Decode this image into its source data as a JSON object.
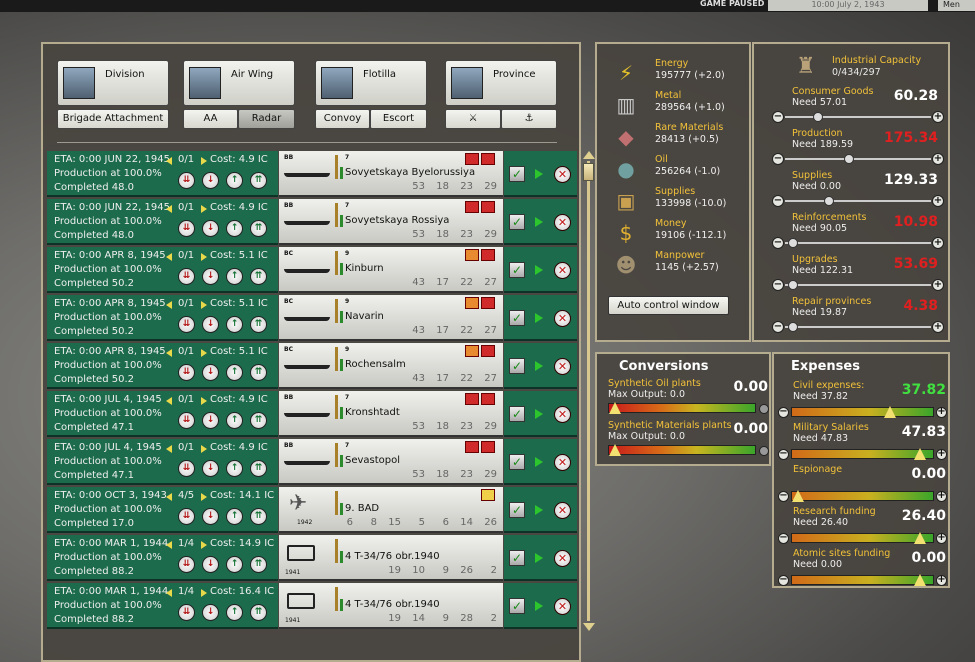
{
  "topbar": {
    "status": "GAME PAUSED",
    "date": "10:00 July 2, 1943",
    "menu": "Men"
  },
  "unit_buttons": [
    {
      "label": "Division"
    },
    {
      "label": "Air Wing"
    },
    {
      "label": "Flotilla"
    },
    {
      "label": "Province"
    }
  ],
  "sub_buttons": {
    "brigade": "Brigade Attachment",
    "aa": "AA",
    "radar": "Radar",
    "convoy": "Convoy",
    "escort": "Escort",
    "province_a": "⚔",
    "province_b": "⚓"
  },
  "queue": [
    {
      "eta": "ETA: 0:00 JUN 22, 1945",
      "qty": "0/1",
      "cost": "Cost: 4.9 IC",
      "prod": "Production at 100.0%",
      "done": "Completed 48.0",
      "cls": "BB",
      "num": "7",
      "name": "Sovyetskaya Byelorussiya",
      "stats": [
        "53",
        "18",
        "23",
        "29"
      ],
      "badges": [
        "red",
        "red"
      ],
      "kind": "ship"
    },
    {
      "eta": "ETA: 0:00 JUN 22, 1945",
      "qty": "0/1",
      "cost": "Cost: 4.9 IC",
      "prod": "Production at 100.0%",
      "done": "Completed 48.0",
      "cls": "BB",
      "num": "7",
      "name": "Sovyetskaya Rossiya",
      "stats": [
        "53",
        "18",
        "23",
        "29"
      ],
      "badges": [
        "red",
        "red"
      ],
      "kind": "ship"
    },
    {
      "eta": "ETA: 0:00 APR 8, 1945",
      "qty": "0/1",
      "cost": "Cost: 5.1 IC",
      "prod": "Production at 100.0%",
      "done": "Completed 50.2",
      "cls": "BC",
      "num": "9",
      "name": "Kinburn",
      "stats": [
        "43",
        "17",
        "22",
        "27"
      ],
      "badges": [
        "o",
        "red"
      ],
      "kind": "ship"
    },
    {
      "eta": "ETA: 0:00 APR 8, 1945",
      "qty": "0/1",
      "cost": "Cost: 5.1 IC",
      "prod": "Production at 100.0%",
      "done": "Completed 50.2",
      "cls": "BC",
      "num": "9",
      "name": "Navarin",
      "stats": [
        "43",
        "17",
        "22",
        "27"
      ],
      "badges": [
        "o",
        "red"
      ],
      "kind": "ship"
    },
    {
      "eta": "ETA: 0:00 APR 8, 1945",
      "qty": "0/1",
      "cost": "Cost: 5.1 IC",
      "prod": "Production at 100.0%",
      "done": "Completed 50.2",
      "cls": "BC",
      "num": "9",
      "name": "Rochensalm",
      "stats": [
        "43",
        "17",
        "22",
        "27"
      ],
      "badges": [
        "o",
        "red"
      ],
      "kind": "ship"
    },
    {
      "eta": "ETA: 0:00 JUL 4, 1945",
      "qty": "0/1",
      "cost": "Cost: 4.9 IC",
      "prod": "Production at 100.0%",
      "done": "Completed 47.1",
      "cls": "BB",
      "num": "7",
      "name": "Kronshtadt",
      "stats": [
        "53",
        "18",
        "23",
        "29"
      ],
      "badges": [
        "red",
        "red"
      ],
      "kind": "ship"
    },
    {
      "eta": "ETA: 0:00 JUL 4, 1945",
      "qty": "0/1",
      "cost": "Cost: 4.9 IC",
      "prod": "Production at 100.0%",
      "done": "Completed 47.1",
      "cls": "BB",
      "num": "7",
      "name": "Sevastopol",
      "stats": [
        "53",
        "18",
        "23",
        "29"
      ],
      "badges": [
        "red",
        "red"
      ],
      "kind": "ship"
    },
    {
      "eta": "ETA: 0:00 OCT 3, 1943",
      "qty": "4/5",
      "cost": "Cost: 14.1 IC",
      "prod": "Production at 100.0%",
      "done": "Completed 17.0",
      "cls": "",
      "num": "",
      "year": "1942",
      "name": "9. BAD",
      "stats": [
        "6",
        "8",
        "15",
        "5",
        "6",
        "14",
        "26"
      ],
      "badges": [
        "y"
      ],
      "kind": "air"
    },
    {
      "eta": "ETA: 0:00 MAR 1, 1944",
      "qty": "1/4",
      "cost": "Cost: 14.9 IC",
      "prod": "Production at 100.0%",
      "done": "Completed 88.2",
      "cls": "",
      "num": "",
      "year": "1941",
      "name": "4 T-34/76 obr.1940",
      "stats": [
        "19",
        "10",
        "9",
        "26",
        "2"
      ],
      "badges": [],
      "kind": "tank"
    },
    {
      "eta": "ETA: 0:00 MAR 1, 1944",
      "qty": "1/4",
      "cost": "Cost: 16.4 IC",
      "prod": "Production at 100.0%",
      "done": "Completed 88.2",
      "cls": "",
      "num": "",
      "year": "1941",
      "name": "4 T-34/76 obr.1940",
      "stats": [
        "19",
        "14",
        "9",
        "28",
        "2"
      ],
      "badges": [],
      "kind": "tank"
    }
  ],
  "resources": [
    {
      "name": "Energy",
      "value": "195777 (+2.0)",
      "icon": "⚡",
      "color": "#e6c22a"
    },
    {
      "name": "Metal",
      "value": "289564 (+1.0)",
      "icon": "▥",
      "color": "#c9c9c9"
    },
    {
      "name": "Rare Materials",
      "value": "28413 (+0.5)",
      "icon": "◆",
      "color": "#c07070"
    },
    {
      "name": "Oil",
      "value": "256264 (-1.0)",
      "icon": "●",
      "color": "#70a0a0"
    },
    {
      "name": "Supplies",
      "value": "133998 (-10.0)",
      "icon": "▣",
      "color": "#c8a050"
    },
    {
      "name": "Money",
      "value": "19106 (-112.1)",
      "icon": "$",
      "color": "#e0b030"
    },
    {
      "name": "Manpower",
      "value": "1145 (+2.57)",
      "icon": "☻",
      "color": "#a09070"
    }
  ],
  "auto_control": "Auto control window",
  "industry": {
    "title": "Industrial Capacity",
    "value": "0/434/297"
  },
  "sliders": [
    {
      "name": "Consumer Goods",
      "need": "Need 57.01",
      "value": "60.28",
      "color": "#ffffff",
      "level": 0.2
    },
    {
      "name": "Production",
      "need": "Need 189.59",
      "value": "175.34",
      "color": "#e02020",
      "level": 0.42
    },
    {
      "name": "Supplies",
      "need": "Need 0.00",
      "value": "129.33",
      "color": "#ffffff",
      "level": 0.28
    },
    {
      "name": "Reinforcements",
      "need": "Need 90.05",
      "value": "10.98",
      "color": "#e02020",
      "level": 0.02
    },
    {
      "name": "Upgrades",
      "need": "Need 122.31",
      "value": "53.69",
      "color": "#e02020",
      "level": 0.02
    },
    {
      "name": "Repair provinces",
      "need": "Need 19.87",
      "value": "4.38",
      "color": "#e02020",
      "level": 0.02
    }
  ],
  "conversions": {
    "title": "Conversions",
    "items": [
      {
        "name": "Synthetic Oil plants",
        "need": "Max Output: 0.0",
        "value": "0.00"
      },
      {
        "name": "Synthetic Materials plants",
        "need": "Max Output: 0.0",
        "value": "0.00"
      }
    ]
  },
  "expenses": {
    "title": "Expenses",
    "items": [
      {
        "name": "Civil expenses:",
        "need": "Need 37.82",
        "value": "37.82",
        "color": "#40e040",
        "level": 0.7
      },
      {
        "name": "Military Salaries",
        "need": "Need 47.83",
        "value": "47.83",
        "color": "#ffffff",
        "level": 0.93
      },
      {
        "name": "Espionage",
        "need": "",
        "value": "0.00",
        "color": "#ffffff",
        "level": 0.0
      },
      {
        "name": "Research funding",
        "need": "Need 26.40",
        "value": "26.40",
        "color": "#ffffff",
        "level": 0.93
      },
      {
        "name": "Atomic sites funding",
        "need": "Need 0.00",
        "value": "0.00",
        "color": "#ffffff",
        "level": 0.93
      }
    ]
  }
}
